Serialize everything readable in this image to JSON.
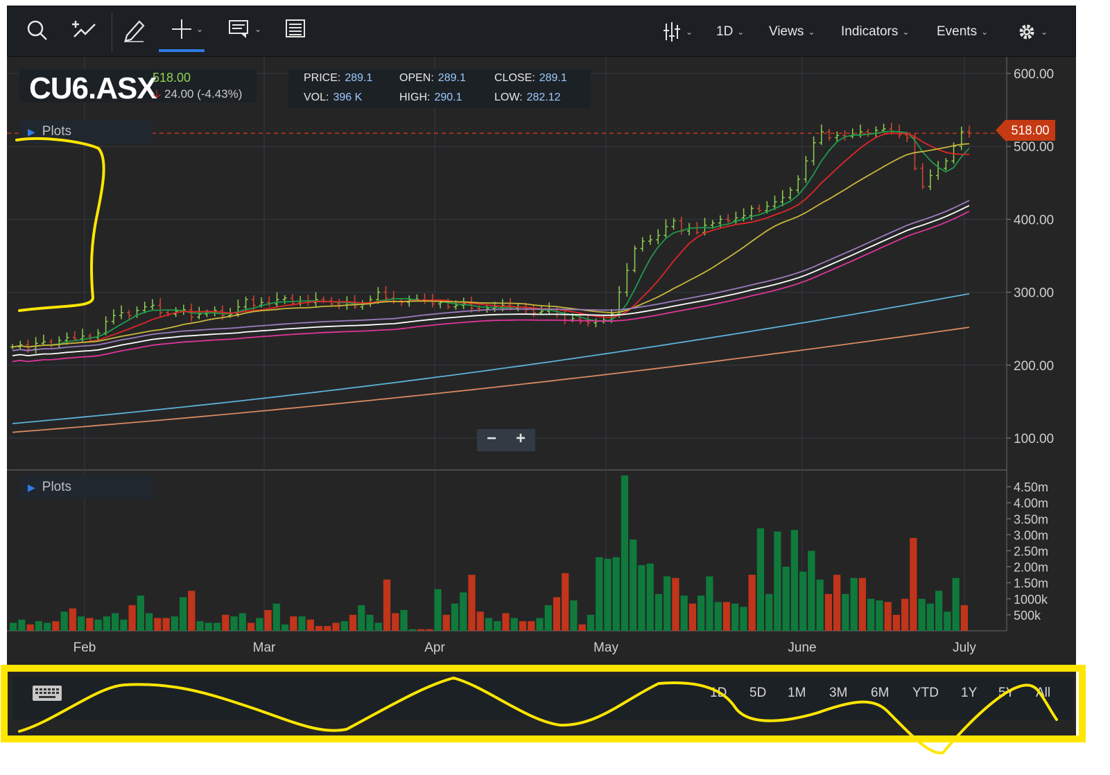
{
  "toolbar": {
    "interval_label": "1D",
    "views_label": "Views",
    "indicators_label": "Indicators",
    "events_label": "Events"
  },
  "quote": {
    "ticker": "CU6.ASX",
    "last": "518.00",
    "change": "24.00 (-4.43%)",
    "price_label": "PRICE:",
    "price": "289.1",
    "open_label": "OPEN:",
    "open": "289.1",
    "close_label": "CLOSE:",
    "close": "289.1",
    "vol_label": "VOL:",
    "vol": "396 K",
    "high_label": "HIGH:",
    "high": "290.1",
    "low_label": "LOW:",
    "low": "282.12"
  },
  "plots_label": "Plots",
  "current_price_tag": "518.00",
  "footer": {
    "ranges": [
      "1D",
      "5D",
      "1M",
      "3M",
      "6M",
      "YTD",
      "1Y",
      "5Y",
      "All"
    ]
  },
  "colors": {
    "up": "#0f7a3c",
    "down": "#c1351a",
    "background": "#252526",
    "ma_green": "#1f9a4b",
    "ma_red": "#e02626",
    "ma_yellow": "#c9b83a",
    "ma_purple": "#9b7bbd",
    "ma_white": "#ffffff",
    "ma_magenta": "#e0359a",
    "ma_blue": "#5db3d8",
    "ma_orange": "#d98a60",
    "annotation": "#ffe600"
  },
  "chart_data": {
    "type": "candlestick",
    "x_ticks": [
      "Feb",
      "Mar",
      "Apr",
      "May",
      "June",
      "July"
    ],
    "price_ticks": [
      "600.00",
      "500.00",
      "400.00",
      "300.00",
      "200.00",
      "100.00"
    ],
    "volume_ticks": [
      "4.50m",
      "4.00m",
      "3.50m",
      "3.00m",
      "2.50m",
      "2.00m",
      "1.50m",
      "1000k",
      "500k"
    ],
    "price_ylim": [
      100,
      600
    ],
    "volume_ylim": [
      0,
      4.5
    ],
    "current_price": 518,
    "close": [
      225,
      228,
      222,
      230,
      232,
      228,
      234,
      238,
      236,
      240,
      238,
      244,
      260,
      268,
      272,
      268,
      275,
      280,
      282,
      272,
      270,
      274,
      276,
      266,
      270,
      272,
      275,
      268,
      270,
      280,
      290,
      282,
      286,
      284,
      290,
      292,
      285,
      288,
      286,
      290,
      288,
      284,
      282,
      286,
      280,
      285,
      290,
      300,
      292,
      288,
      286,
      290,
      290,
      288,
      284,
      286,
      280,
      282,
      284,
      278,
      276,
      278,
      280,
      282,
      278,
      280,
      276,
      272,
      274,
      276,
      270,
      262,
      264,
      260,
      258,
      260,
      262,
      270,
      300,
      330,
      360,
      370,
      372,
      378,
      390,
      398,
      384,
      388,
      382,
      392,
      395,
      400,
      398,
      402,
      405,
      415,
      412,
      418,
      424,
      430,
      440,
      455,
      480,
      505,
      520,
      512,
      515,
      514,
      516,
      520,
      518,
      522,
      524,
      520,
      516,
      512,
      470,
      445,
      460,
      470,
      480,
      500,
      520,
      518
    ],
    "volume": [
      0.25,
      0.35,
      0.2,
      0.3,
      0.25,
      0.3,
      0.6,
      0.7,
      0.45,
      0.4,
      0.35,
      0.45,
      0.55,
      0.35,
      0.8,
      1.1,
      0.55,
      0.4,
      0.4,
      0.45,
      1.05,
      1.25,
      0.3,
      0.25,
      0.25,
      0.5,
      0.45,
      0.55,
      0.25,
      0.4,
      0.65,
      0.85,
      0.2,
      0.45,
      0.45,
      0.35,
      0.15,
      0.15,
      0.25,
      0.3,
      0.5,
      0.8,
      0.5,
      0.25,
      1.6,
      0.55,
      0.65,
      0.05,
      0.05,
      0.05,
      1.3,
      0.5,
      0.85,
      1.2,
      1.75,
      0.6,
      0.4,
      0.3,
      0.55,
      0.4,
      0.3,
      0.3,
      0.4,
      0.8,
      1.05,
      1.8,
      0.95,
      0.2,
      0.5,
      2.3,
      2.25,
      2.3,
      4.85,
      2.85,
      2.05,
      2.1,
      1.15,
      1.7,
      1.65,
      1.1,
      0.85,
      1.1,
      1.7,
      0.9,
      0.9,
      0.85,
      0.75,
      1.75,
      3.2,
      1.15,
      3.1,
      2.0,
      3.15,
      1.85,
      2.5,
      1.6,
      1.15,
      1.75,
      1.15,
      1.65,
      1.65,
      1.0,
      0.95,
      0.9,
      0.5,
      1.0,
      2.9,
      1.0,
      0.85,
      1.25,
      0.6,
      1.65,
      0.8
    ]
  }
}
